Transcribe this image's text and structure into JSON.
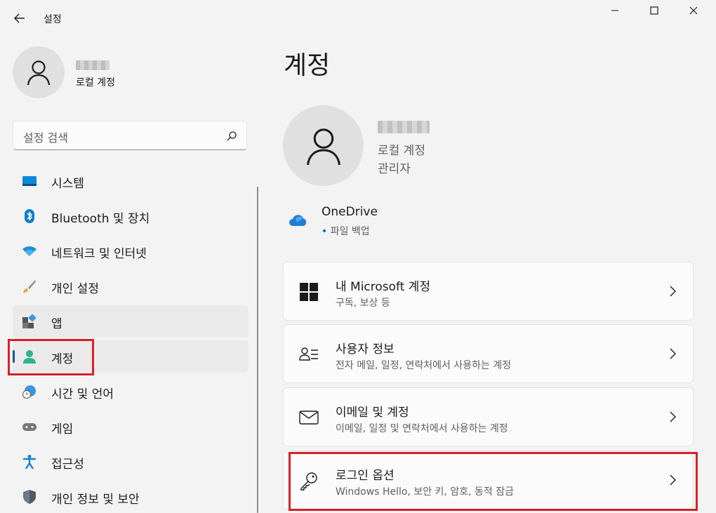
{
  "window": {
    "title": "설정",
    "back_icon": "back-arrow-icon",
    "minimize_icon": "minimize-icon",
    "maximize_icon": "maximize-icon",
    "close_icon": "close-icon"
  },
  "sidebar": {
    "profile": {
      "account_type": "로컬 계정"
    },
    "search": {
      "placeholder": "설정 검색"
    },
    "items": [
      {
        "label": "시스템",
        "icon": "system-icon"
      },
      {
        "label": "Bluetooth 및 장치",
        "icon": "bluetooth-icon"
      },
      {
        "label": "네트워크 및 인터넷",
        "icon": "wifi-icon"
      },
      {
        "label": "개인 설정",
        "icon": "paintbrush-icon"
      },
      {
        "label": "앱",
        "icon": "apps-icon"
      },
      {
        "label": "계정",
        "icon": "account-icon",
        "selected": true
      },
      {
        "label": "시간 및 언어",
        "icon": "globe-clock-icon"
      },
      {
        "label": "게임",
        "icon": "gamepad-icon"
      },
      {
        "label": "접근성",
        "icon": "accessibility-icon"
      },
      {
        "label": "개인 정보 및 보안",
        "icon": "shield-icon"
      }
    ]
  },
  "main": {
    "title": "계정",
    "profile": {
      "account_type": "로컬 계정",
      "role": "관리자"
    },
    "onedrive": {
      "title": "OneDrive",
      "subtitle": "파일 백업"
    },
    "cards": [
      {
        "title": "내 Microsoft 계정",
        "subtitle": "구독, 보상 등",
        "icon": "microsoft-logo-icon"
      },
      {
        "title": "사용자 정보",
        "subtitle": "전자 메일, 일정, 연락처에서 사용하는 계정",
        "icon": "user-info-icon"
      },
      {
        "title": "이메일 및 계정",
        "subtitle": "이메일, 일정 및 연락처에서 사용하는 계정",
        "icon": "mail-icon"
      },
      {
        "title": "로그인 옵션",
        "subtitle": "Windows Hello, 보안 키, 암호, 동적 잠금",
        "icon": "key-icon"
      }
    ]
  },
  "colors": {
    "accent": "#005a9e",
    "highlight_box": "#d9202a",
    "background": "#f3f3f3"
  }
}
